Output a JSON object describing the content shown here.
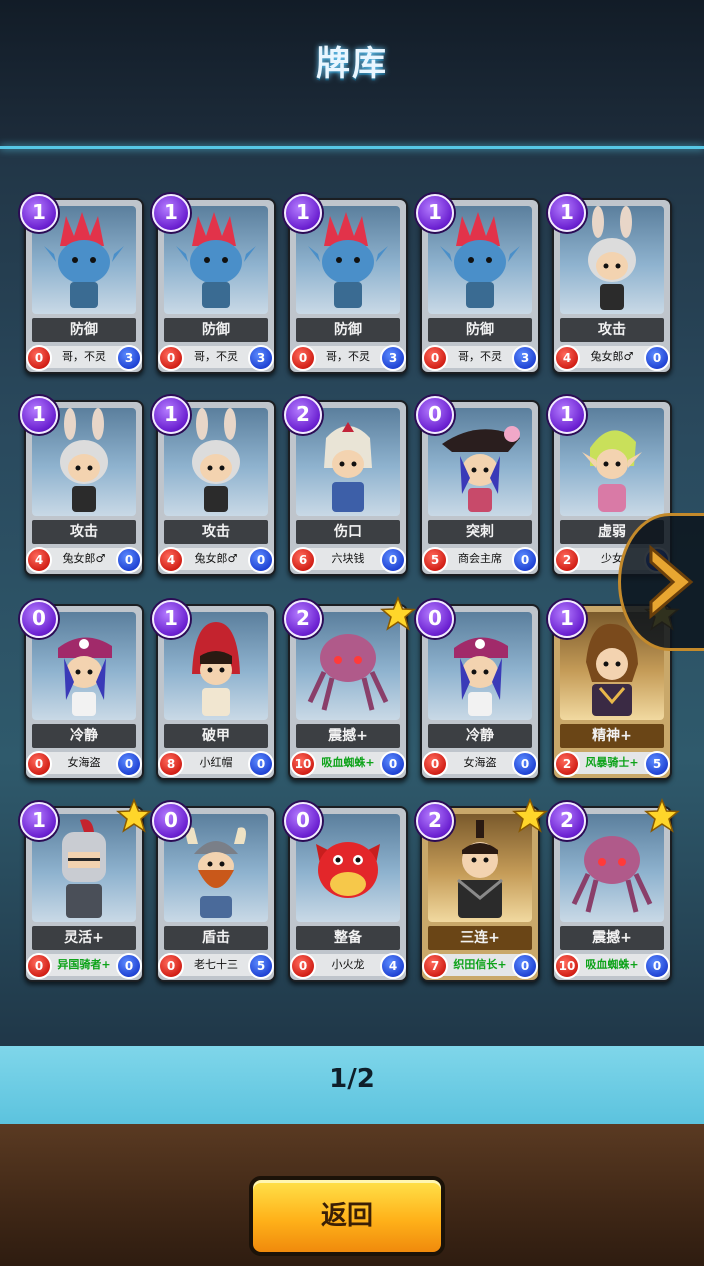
{
  "header": {
    "title": "牌库"
  },
  "cards": [
    {
      "cost": "1",
      "name": "防御",
      "owner": "哥，不灵",
      "atk": "0",
      "hp": "3",
      "star": false,
      "gold": false,
      "green": false,
      "art": "troll"
    },
    {
      "cost": "1",
      "name": "防御",
      "owner": "哥，不灵",
      "atk": "0",
      "hp": "3",
      "star": false,
      "gold": false,
      "green": false,
      "art": "troll"
    },
    {
      "cost": "1",
      "name": "防御",
      "owner": "哥，不灵",
      "atk": "0",
      "hp": "3",
      "star": false,
      "gold": false,
      "green": false,
      "art": "troll"
    },
    {
      "cost": "1",
      "name": "防御",
      "owner": "哥，不灵",
      "atk": "0",
      "hp": "3",
      "star": false,
      "gold": false,
      "green": false,
      "art": "troll"
    },
    {
      "cost": "1",
      "name": "攻击",
      "owner": "兔女郎♂",
      "atk": "4",
      "hp": "0",
      "star": false,
      "gold": false,
      "green": false,
      "art": "bunny"
    },
    {
      "cost": "1",
      "name": "攻击",
      "owner": "兔女郎♂",
      "atk": "4",
      "hp": "0",
      "star": false,
      "gold": false,
      "green": false,
      "art": "bunny"
    },
    {
      "cost": "1",
      "name": "攻击",
      "owner": "兔女郎♂",
      "atk": "4",
      "hp": "0",
      "star": false,
      "gold": false,
      "green": false,
      "art": "bunny"
    },
    {
      "cost": "2",
      "name": "伤口",
      "owner": "六块钱",
      "atk": "6",
      "hp": "0",
      "star": false,
      "gold": false,
      "green": false,
      "art": "knight"
    },
    {
      "cost": "0",
      "name": "突刺",
      "owner": "商会主席",
      "atk": "5",
      "hp": "0",
      "star": false,
      "gold": false,
      "green": false,
      "art": "pirate-hat"
    },
    {
      "cost": "1",
      "name": "虚弱",
      "owner": "少女",
      "atk": "2",
      "hp": "0",
      "star": false,
      "gold": false,
      "green": false,
      "art": "elf"
    },
    {
      "cost": "0",
      "name": "冷静",
      "owner": "女海盗",
      "atk": "0",
      "hp": "0",
      "star": false,
      "gold": false,
      "green": false,
      "art": "pirate"
    },
    {
      "cost": "1",
      "name": "破甲",
      "owner": "小红帽",
      "atk": "8",
      "hp": "0",
      "star": false,
      "gold": false,
      "green": false,
      "art": "redhood"
    },
    {
      "cost": "2",
      "name": "震撼+",
      "owner": "吸血蜘蛛+",
      "atk": "10",
      "hp": "0",
      "star": true,
      "gold": false,
      "green": true,
      "art": "spider"
    },
    {
      "cost": "0",
      "name": "冷静",
      "owner": "女海盗",
      "atk": "0",
      "hp": "0",
      "star": false,
      "gold": false,
      "green": false,
      "art": "pirate"
    },
    {
      "cost": "1",
      "name": "精神+",
      "owner": "风暴骑士+",
      "atk": "2",
      "hp": "5",
      "star": true,
      "gold": true,
      "green": true,
      "art": "storm"
    },
    {
      "cost": "1",
      "name": "灵活+",
      "owner": "异国骑者+",
      "atk": "0",
      "hp": "0",
      "star": true,
      "gold": false,
      "green": true,
      "art": "helmet"
    },
    {
      "cost": "0",
      "name": "盾击",
      "owner": "老七十三",
      "atk": "0",
      "hp": "5",
      "star": false,
      "gold": false,
      "green": false,
      "art": "viking"
    },
    {
      "cost": "0",
      "name": "整备",
      "owner": "小火龙",
      "atk": "0",
      "hp": "4",
      "star": false,
      "gold": false,
      "green": false,
      "art": "dragon"
    },
    {
      "cost": "2",
      "name": "三连+",
      "owner": "织田信长+",
      "atk": "7",
      "hp": "0",
      "star": true,
      "gold": true,
      "green": true,
      "art": "samurai"
    },
    {
      "cost": "2",
      "name": "震撼+",
      "owner": "吸血蜘蛛+",
      "atk": "10",
      "hp": "0",
      "star": true,
      "gold": false,
      "green": true,
      "art": "spider"
    }
  ],
  "pager": {
    "text": "1/2"
  },
  "back_button": {
    "label": "返回"
  },
  "colors": {
    "accent": "#56c7e6",
    "cost_purple": "#6a1fd0",
    "attack_red": "#cf1b12",
    "hp_blue": "#1d3fd1",
    "button_gold": "#ffb21a"
  },
  "icons": {
    "next": "chevron-right-icon",
    "star": "star-icon"
  }
}
